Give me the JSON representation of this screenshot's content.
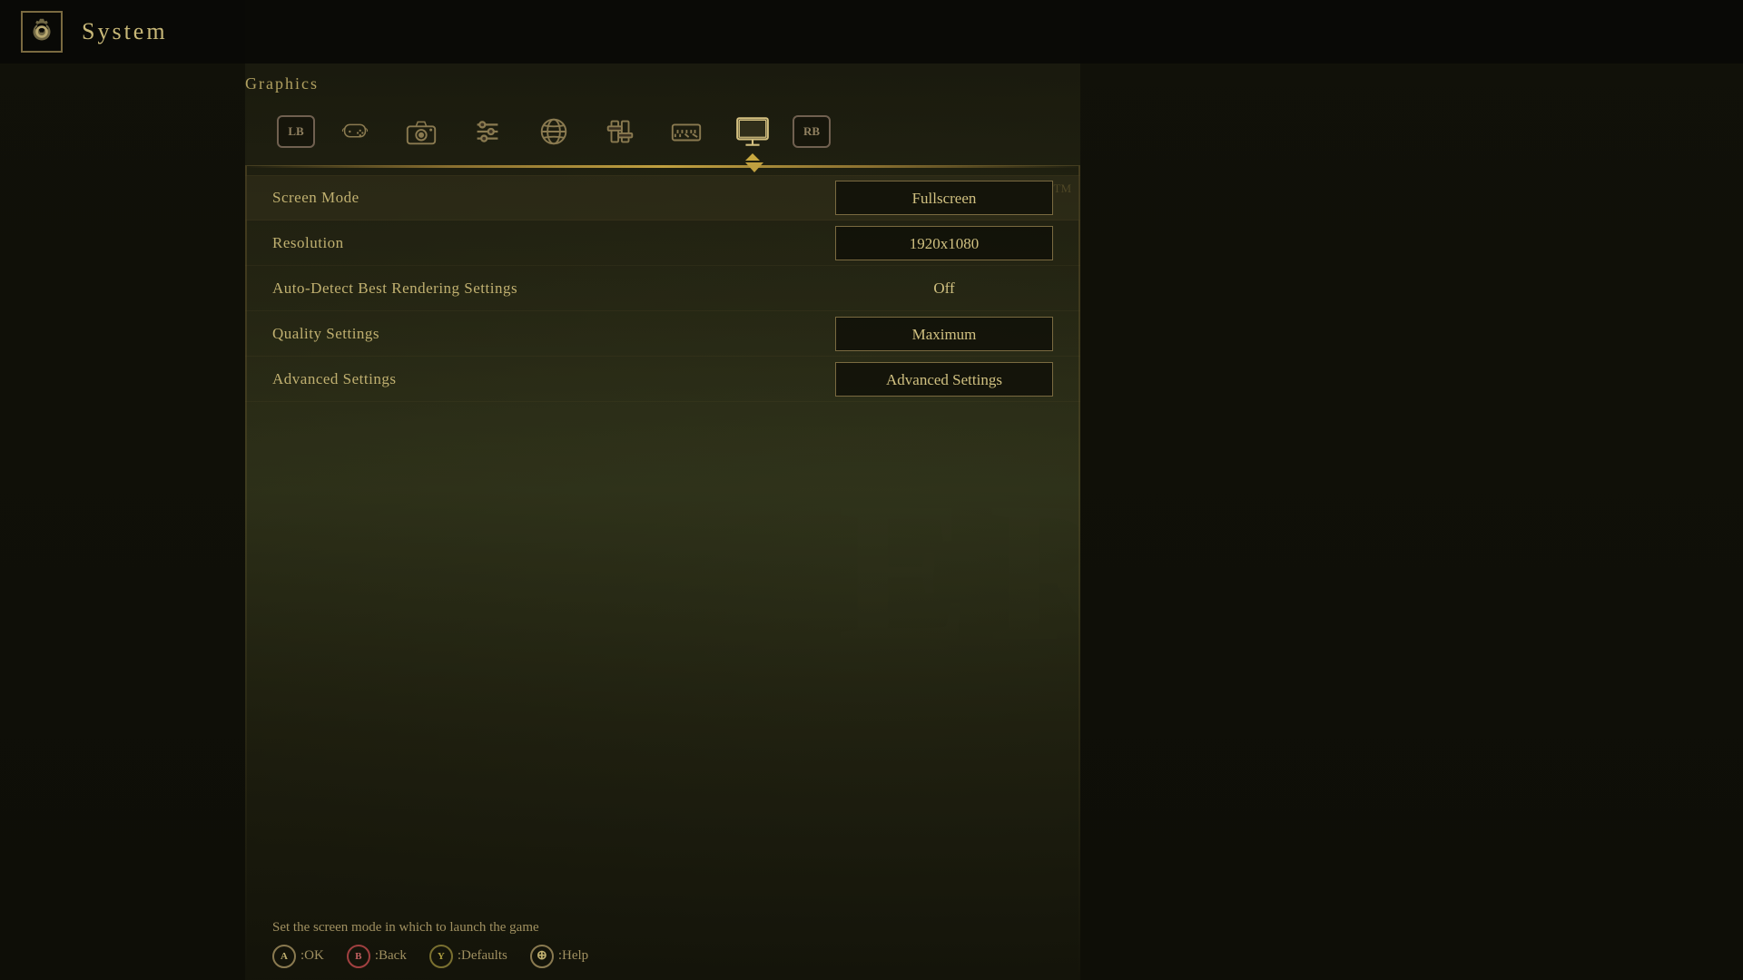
{
  "header": {
    "title": "System",
    "gear_icon": "⚙"
  },
  "section": {
    "title": "Graphics"
  },
  "tabs": [
    {
      "label": "LB",
      "icon": "🎮",
      "type": "lb",
      "active": false
    },
    {
      "label": "🎮",
      "icon": "controller",
      "active": false
    },
    {
      "label": "📷",
      "icon": "camera",
      "active": false
    },
    {
      "label": "⚙",
      "icon": "settings",
      "active": false
    },
    {
      "label": "🌐",
      "icon": "globe",
      "active": false
    },
    {
      "label": "⚙",
      "icon": "settings2",
      "active": false
    },
    {
      "label": "⌨",
      "icon": "keyboard",
      "active": false
    },
    {
      "label": "🖥",
      "icon": "monitor",
      "active": true
    },
    {
      "label": "RB",
      "icon": "rb",
      "type": "rb",
      "active": false
    }
  ],
  "settings": [
    {
      "label": "Screen Mode",
      "value": "Fullscreen",
      "type": "button"
    },
    {
      "label": "Resolution",
      "value": "1920x1080",
      "type": "button"
    },
    {
      "label": "Auto-Detect Best Rendering Settings",
      "value": "Off",
      "type": "text"
    },
    {
      "label": "Quality Settings",
      "value": "Maximum",
      "type": "button"
    },
    {
      "label": "Advanced Settings",
      "value": "Advanced Settings",
      "type": "button"
    }
  ],
  "bottom": {
    "hint": "Set the screen mode in which to launch the game",
    "controls": [
      {
        "btn": "A",
        "label": ":OK"
      },
      {
        "btn": "B",
        "label": ":Back"
      },
      {
        "btn": "Y",
        "label": ":Defaults"
      },
      {
        "btn": "⊕",
        "label": ":Help"
      }
    ]
  }
}
